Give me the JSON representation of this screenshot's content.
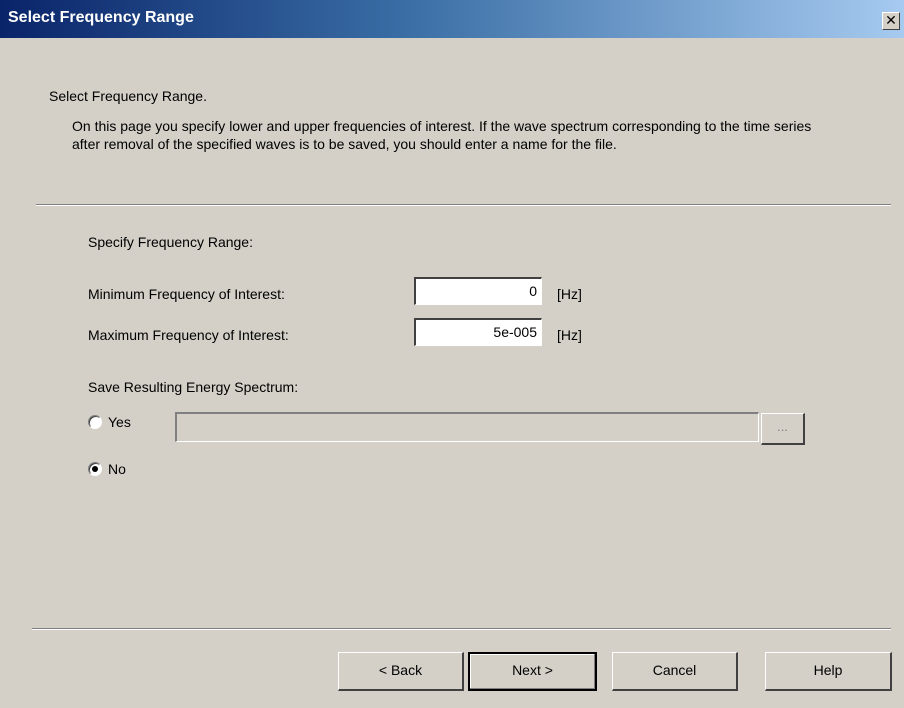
{
  "window": {
    "title": "Select Frequency Range",
    "close_glyph": "✕",
    "close_icon": "close-icon"
  },
  "header": {
    "title": "Select Frequency Range.",
    "description": "On this page you specify lower and upper frequencies of interest. If the wave spectrum corresponding to the time series after removal of the specified waves is to be saved, you should enter a name for the file."
  },
  "frequency": {
    "section_label": "Specify Frequency Range:",
    "min_label": "Minimum Frequency of Interest:",
    "min_value": "0",
    "min_unit": "[Hz]",
    "max_label": "Maximum Frequency of Interest:",
    "max_value": "5e-005",
    "max_unit": "[Hz]"
  },
  "save": {
    "section_label": "Save Resulting Energy Spectrum:",
    "yes_label": "Yes",
    "no_label": "No",
    "selected": "No",
    "file_path": "",
    "browse_label": "..."
  },
  "buttons": {
    "back": "< Back",
    "next": "Next >",
    "cancel": "Cancel",
    "help": "Help"
  },
  "colors": {
    "face": "#d4d0c8",
    "title_start": "#0a246a",
    "title_end": "#a6caf0"
  }
}
